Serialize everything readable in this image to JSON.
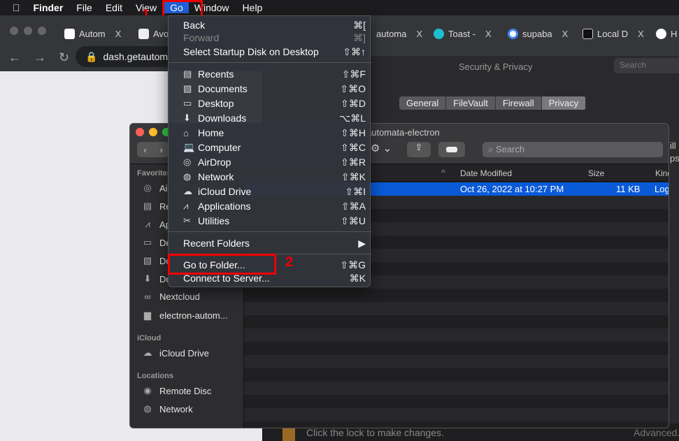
{
  "menubar": {
    "apple": "",
    "items": [
      "Finder",
      "File",
      "Edit",
      "View",
      "Go",
      "Window",
      "Help"
    ]
  },
  "annotations": {
    "step1": "1",
    "step2": "2",
    "highlight_color": "#e00000"
  },
  "browser": {
    "tabs": [
      {
        "label": "Autom",
        "icon": "notion-icon"
      },
      {
        "label": "Avo",
        "icon": "hashtag-icon"
      },
      {
        "label": "automa",
        "icon": "automa-icon"
      },
      {
        "label": "Toast -",
        "icon": "bolt-icon"
      },
      {
        "label": "supaba",
        "icon": "google-icon"
      },
      {
        "label": "Local D",
        "icon": "local-icon"
      },
      {
        "label": "H",
        "icon": "github-icon"
      }
    ],
    "close": "X",
    "address": "dash.getautom"
  },
  "sysprefs": {
    "title": "Security & Privacy",
    "search_placeholder": "Search",
    "tabs": [
      "General",
      "FileVault",
      "Firewall",
      "Privacy"
    ],
    "active_tab": "Privacy",
    "lock_text": "Click the lock to make changes.",
    "advanced": "Advanced...",
    "side_text": [
      "ill",
      "ps"
    ]
  },
  "finder": {
    "title": "automata-electron",
    "search_placeholder": "Search",
    "columns": [
      "Date Modified",
      "Size",
      "Kind"
    ],
    "selected_row": {
      "date": "Oct 26, 2022 at 10:27 PM",
      "size": "11 KB",
      "kind": "Log"
    },
    "sidebar": {
      "favorites": "Favorites",
      "fav_items": [
        "Ai",
        "Re",
        "Ap",
        "De",
        "Do",
        "Do",
        "Nextcloud",
        "electron-autom..."
      ],
      "icloud": "iCloud",
      "icloud_items": [
        "iCloud Drive"
      ],
      "locations": "Locations",
      "loc_items": [
        "Remote Disc",
        "Network"
      ]
    }
  },
  "go_menu": {
    "items": [
      {
        "label": "Back",
        "shortcut": "⌘[",
        "enabled": true
      },
      {
        "label": "Forward",
        "shortcut": "⌘]",
        "enabled": false
      },
      {
        "label": "Select Startup Disk on Desktop",
        "shortcut": "⇧⌘↑",
        "enabled": true
      },
      {
        "label": "Recents",
        "shortcut": "⇧⌘F",
        "icon": "▤"
      },
      {
        "label": "Documents",
        "shortcut": "⇧⌘O",
        "icon": "▧"
      },
      {
        "label": "Desktop",
        "shortcut": "⇧⌘D",
        "icon": "▭"
      },
      {
        "label": "Downloads",
        "shortcut": "⌥⌘L",
        "icon": "⬇"
      },
      {
        "label": "Home",
        "shortcut": "⇧⌘H",
        "icon": "⌂"
      },
      {
        "label": "Computer",
        "shortcut": "⇧⌘C",
        "icon": "💻"
      },
      {
        "label": "AirDrop",
        "shortcut": "⇧⌘R",
        "icon": "◎"
      },
      {
        "label": "Network",
        "shortcut": "⇧⌘K",
        "icon": "◍"
      },
      {
        "label": "iCloud Drive",
        "shortcut": "⇧⌘I",
        "icon": "☁"
      },
      {
        "label": "Applications",
        "shortcut": "⇧⌘A",
        "icon": "⩘"
      },
      {
        "label": "Utilities",
        "shortcut": "⇧⌘U",
        "icon": "✂"
      },
      {
        "label": "Recent Folders",
        "shortcut": "▶"
      },
      {
        "label": "Go to Folder...",
        "shortcut": "⇧⌘G"
      },
      {
        "label": "Connect to Server...",
        "shortcut": "⌘K"
      }
    ]
  }
}
